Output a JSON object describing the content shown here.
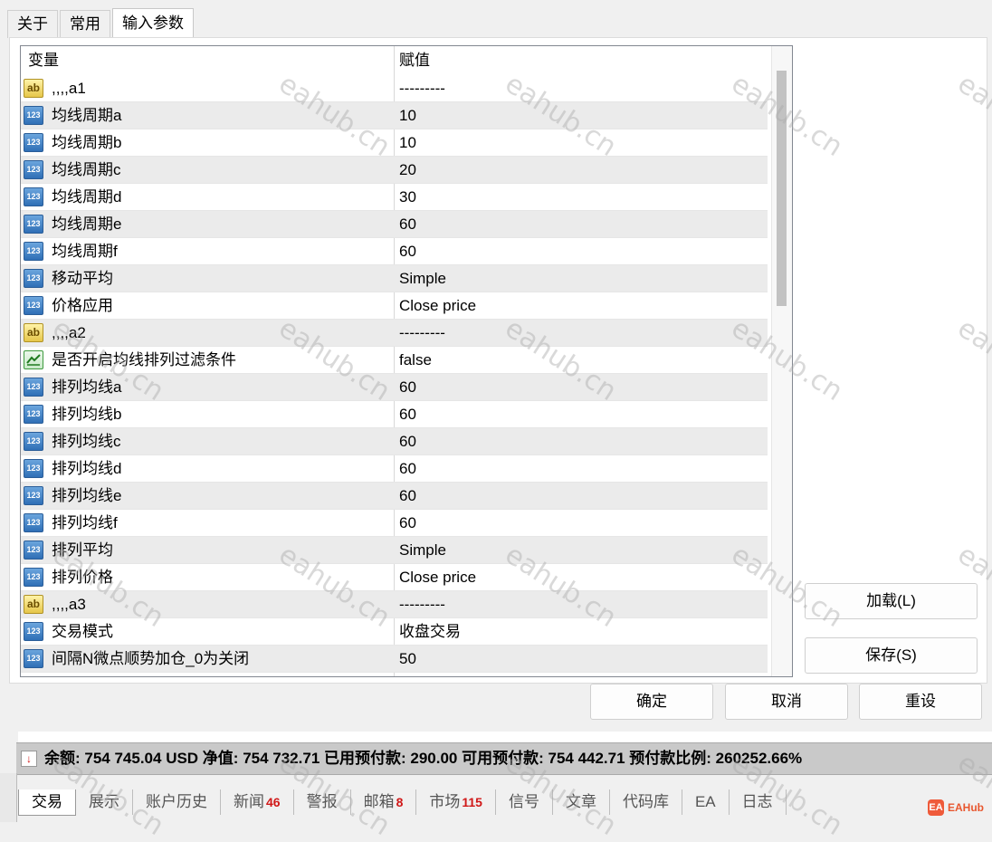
{
  "tabs": [
    {
      "label": "关于",
      "active": false
    },
    {
      "label": "常用",
      "active": false
    },
    {
      "label": "输入参数",
      "active": true
    }
  ],
  "grid": {
    "col_variable": "变量",
    "col_value": "赋值",
    "rows": [
      {
        "icon": "string",
        "name": ",,,,a1",
        "value": "---------"
      },
      {
        "icon": "number",
        "name": "均线周期a",
        "value": "10"
      },
      {
        "icon": "number",
        "name": "均线周期b",
        "value": "10"
      },
      {
        "icon": "number",
        "name": "均线周期c",
        "value": "20"
      },
      {
        "icon": "number",
        "name": "均线周期d",
        "value": "30"
      },
      {
        "icon": "number",
        "name": "均线周期e",
        "value": "60"
      },
      {
        "icon": "number",
        "name": "均线周期f",
        "value": "60"
      },
      {
        "icon": "number",
        "name": "移动平均",
        "value": "Simple"
      },
      {
        "icon": "number",
        "name": "价格应用",
        "value": "Close price"
      },
      {
        "icon": "string",
        "name": ",,,,a2",
        "value": "---------"
      },
      {
        "icon": "bool",
        "name": "是否开启均线排列过滤条件",
        "value": "false"
      },
      {
        "icon": "number",
        "name": "排列均线a",
        "value": "60"
      },
      {
        "icon": "number",
        "name": "排列均线b",
        "value": "60"
      },
      {
        "icon": "number",
        "name": "排列均线c",
        "value": "60"
      },
      {
        "icon": "number",
        "name": "排列均线d",
        "value": "60"
      },
      {
        "icon": "number",
        "name": "排列均线e",
        "value": "60"
      },
      {
        "icon": "number",
        "name": "排列均线f",
        "value": "60"
      },
      {
        "icon": "number",
        "name": "排列平均",
        "value": "Simple"
      },
      {
        "icon": "number",
        "name": "排列价格",
        "value": "Close price"
      },
      {
        "icon": "string",
        "name": ",,,,a3",
        "value": "---------"
      },
      {
        "icon": "number",
        "name": "交易模式",
        "value": "收盘交易"
      },
      {
        "icon": "number",
        "name": "间隔N微点顺势加仓_0为关闭",
        "value": "50"
      }
    ]
  },
  "buttons": {
    "load": "加载(L)",
    "save": "保存(S)",
    "ok": "确定",
    "cancel": "取消",
    "reset": "重设"
  },
  "status_bar": {
    "text": "余额: 754 745.04 USD  净值: 754 732.71  已用预付款: 290.00  可用预付款: 754 442.71  预付款比例: 260252.66%"
  },
  "bottom_tabs": [
    {
      "label": "交易",
      "count": "",
      "active": true
    },
    {
      "label": "展示",
      "count": ""
    },
    {
      "label": "账户历史",
      "count": ""
    },
    {
      "label": "新闻",
      "count": "46"
    },
    {
      "label": "警报",
      "count": ""
    },
    {
      "label": "邮箱",
      "count": "8"
    },
    {
      "label": "市场",
      "count": "115"
    },
    {
      "label": "信号",
      "count": ""
    },
    {
      "label": "文章",
      "count": ""
    },
    {
      "label": "代码库",
      "count": ""
    },
    {
      "label": "EA",
      "count": ""
    },
    {
      "label": "日志",
      "count": ""
    }
  ],
  "logo": {
    "text": "EAHub"
  },
  "watermark": {
    "text": "eahub.cn"
  },
  "colors": {
    "count_red": "#d01818",
    "selected_tab_bg": "#ffffff",
    "status_bar_bg": "#c9c9c9"
  }
}
